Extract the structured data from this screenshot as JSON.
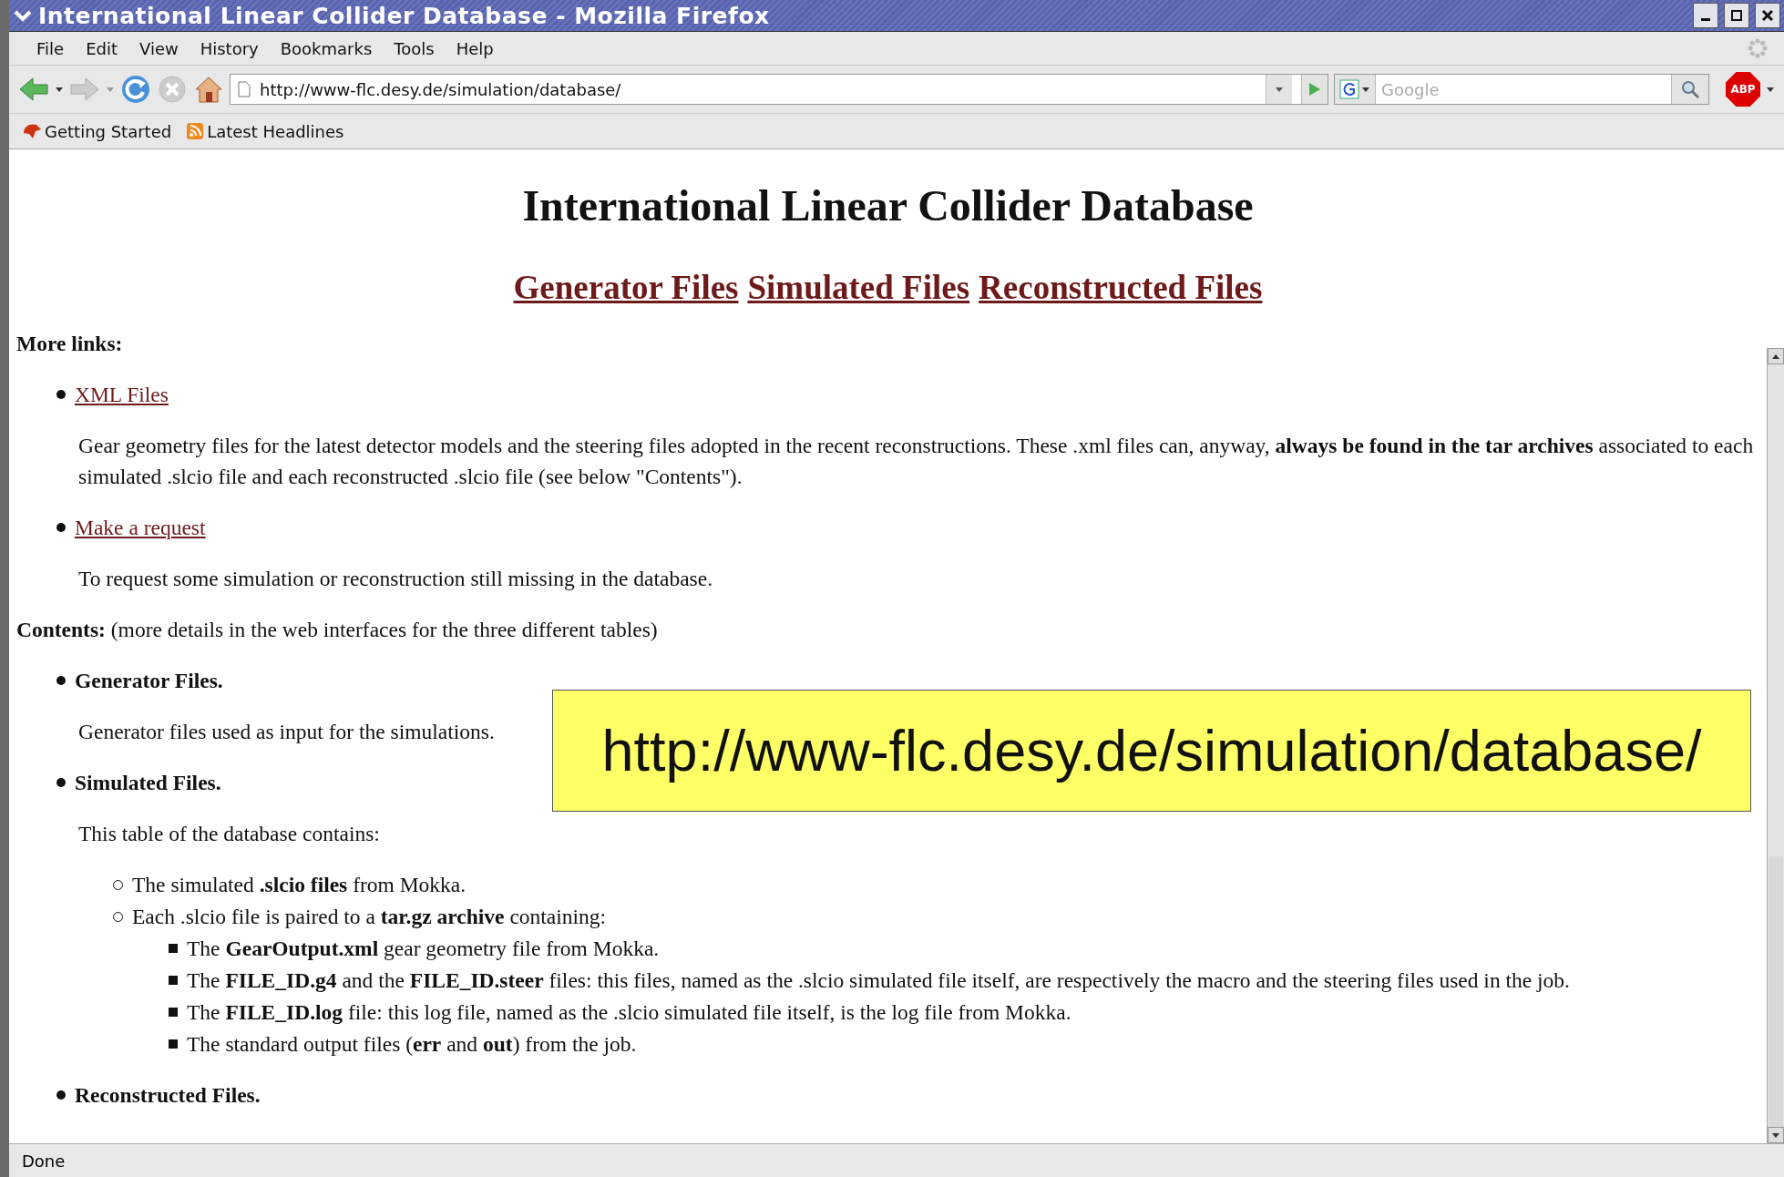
{
  "window": {
    "title": "International Linear Collider Database - Mozilla Firefox"
  },
  "menu": [
    "File",
    "Edit",
    "View",
    "History",
    "Bookmarks",
    "Tools",
    "Help"
  ],
  "toolbar": {
    "url": "http://www-flc.desy.de/simulation/database/",
    "search_placeholder": "Google",
    "adblock_label": "ABP"
  },
  "bookmarks": [
    "Getting Started",
    "Latest Headlines"
  ],
  "page": {
    "heading": "International Linear Collider Database",
    "nav_links": [
      "Generator Files",
      "Simulated Files",
      "Reconstructed Files"
    ],
    "blocks": [
      {
        "kind": "label",
        "text": "**More links:**"
      },
      {
        "kind": "disc_link",
        "text": "XML Files"
      },
      {
        "kind": "para",
        "text": "Gear geometry files for the latest detector models and the steering files adopted in the recent reconstructions. These .xml files can, anyway, **always be found in the tar archives** associated to each simulated .slcio file and each reconstructed .slcio file (see below \"Contents\")."
      },
      {
        "kind": "disc_link",
        "text": "Make a request"
      },
      {
        "kind": "para",
        "text": "To request some simulation or reconstruction still missing in the database."
      },
      {
        "kind": "label",
        "text": "**Contents:** (more details in the web interfaces for the three different tables)"
      },
      {
        "kind": "disc_title",
        "text": "Generator Files."
      },
      {
        "kind": "para",
        "text": "Generator files used as input for the simulations."
      },
      {
        "kind": "disc_title",
        "text": "Simulated Files."
      },
      {
        "kind": "para",
        "text": "This table of the database contains:"
      },
      {
        "kind": "circle",
        "text": "The simulated **.slcio files** from Mokka."
      },
      {
        "kind": "circle",
        "text": "Each .slcio file is paired to a **tar.gz archive** containing:"
      },
      {
        "kind": "square",
        "text": "The **GearOutput.xml** gear geometry file from Mokka."
      },
      {
        "kind": "square",
        "text": "The **FILE_ID.g4** and the **FILE_ID.steer** files: this files, named as the .slcio simulated file itself, are respectively the macro and the steering files used in the job."
      },
      {
        "kind": "square",
        "text": "The **FILE_ID.log** file: this log file, named as the .slcio simulated file itself, is the log file from Mokka."
      },
      {
        "kind": "square",
        "text": "The standard output files (**err** and **out**) from the job."
      },
      {
        "kind": "disc_title",
        "text": "Reconstructed Files."
      }
    ]
  },
  "callout": {
    "text": "http://www-flc.desy.de/simulation/database/"
  },
  "status_bar": "Done"
}
